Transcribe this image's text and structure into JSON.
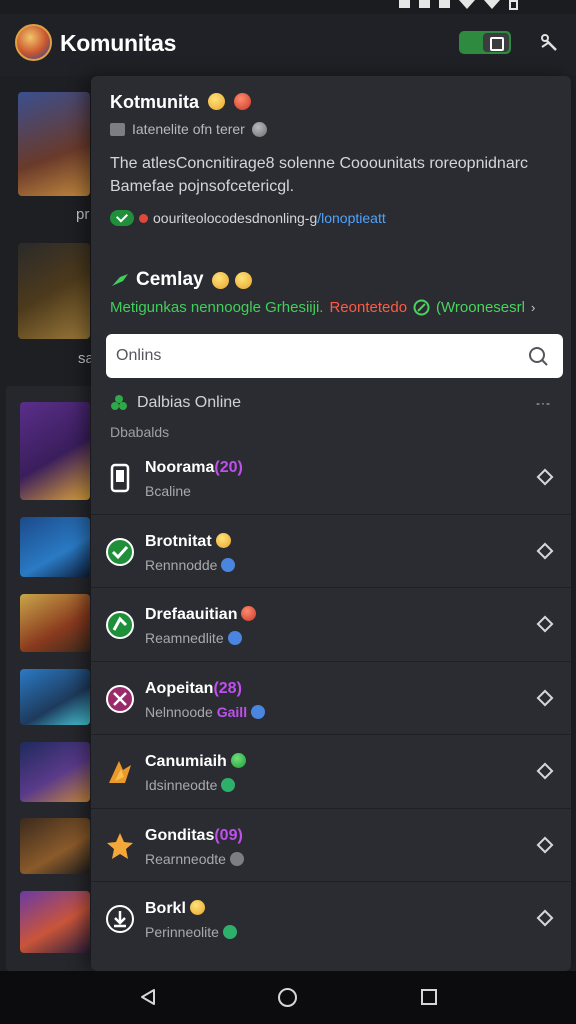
{
  "app": {
    "title": "Komunitas",
    "colors": {
      "accent_green": "#2e8a3e",
      "link_blue": "#4ea3ff",
      "badge_purple": "#c04ff0",
      "tag_red": "#ff5a44"
    }
  },
  "background_list": {
    "labels": [
      "pr",
      "sa"
    ]
  },
  "card": {
    "title": "Kotmunita",
    "subtitle": "Iatenelite ofn terer",
    "description": "The atlesConcnitirage8 solenne Cooounitats roreopnidnarc Bamefae pojnsofcetericgl.",
    "link_text": "oouriteolocodesdnonling-g",
    "link_accent": "/lonoptieatt",
    "section_title": "Cemlay",
    "tags": {
      "part1": "Metigunkas nennoogle Grhesiiji.",
      "part2": "Reontetedo",
      "part3": "(Wroonesesrl",
      "chevron": "›"
    },
    "search": {
      "placeholder": "Onlins"
    },
    "online_header": "Dalbias Online",
    "collapse_symbol": "-·-",
    "group_label": "Dbabalds"
  },
  "members": [
    {
      "name": "Noorama",
      "name_badge": "(20)",
      "subtitle": "Bcaline",
      "sub_badge": "",
      "icon": "phone-icon",
      "emoji": ""
    },
    {
      "name": "Brotnitat",
      "name_badge": "",
      "subtitle": "Rennnodde",
      "sub_badge": "",
      "icon": "green-check-icon",
      "emoji": "yellow"
    },
    {
      "name": "Drefaauitian",
      "name_badge": "",
      "subtitle": "Reamnedlite",
      "sub_badge": "",
      "icon": "green-slash-icon",
      "emoji": "red"
    },
    {
      "name": "Aopeitan",
      "name_badge": "(28)",
      "subtitle": "Nelnnoode",
      "sub_badge": "Gaill",
      "icon": "pink-x-icon",
      "emoji": ""
    },
    {
      "name": "Canumiaih",
      "name_badge": "",
      "subtitle": "Idsinneodte",
      "sub_badge": "",
      "icon": "orange-flame-icon",
      "emoji": "green"
    },
    {
      "name": "Gonditas",
      "name_badge": "(09)",
      "subtitle": "Rearnneodte",
      "sub_badge": "",
      "icon": "star-icon",
      "emoji": ""
    },
    {
      "name": "Borkl",
      "name_badge": "",
      "subtitle": "Perinneolite",
      "sub_badge": "",
      "icon": "download-icon",
      "emoji": "yellow"
    }
  ]
}
